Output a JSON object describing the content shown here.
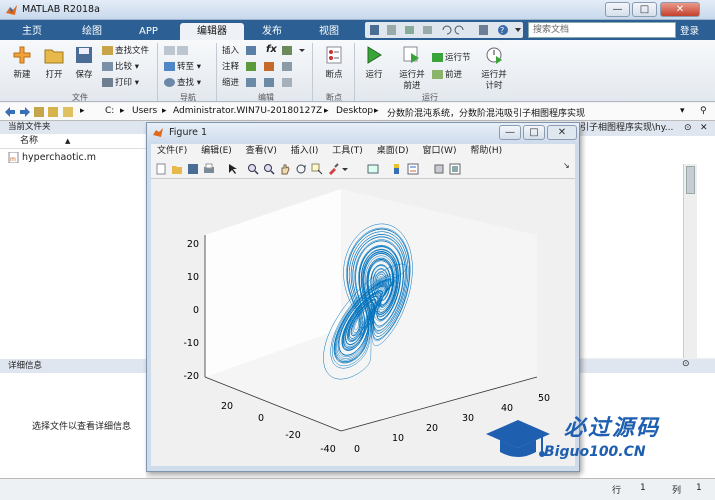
{
  "app": {
    "title": "MATLAB R2018a",
    "login": "登录"
  },
  "window_buttons": {
    "minimize": "—",
    "maximize": "□",
    "close": "✕"
  },
  "tabs": [
    {
      "label": "主页",
      "active": false
    },
    {
      "label": "绘图",
      "active": false
    },
    {
      "label": "APP",
      "active": false
    },
    {
      "label": "编辑器",
      "active": true
    },
    {
      "label": "发布",
      "active": false
    },
    {
      "label": "视图",
      "active": false
    }
  ],
  "search": {
    "placeholder": "搜索文档"
  },
  "ribbon": {
    "file": {
      "new": "新建",
      "open": "打开",
      "save": "保存",
      "find_files": "查找文件",
      "compare": "比较",
      "print": "打印",
      "section": "文件"
    },
    "navigate": {
      "goto": "转至",
      "find": "查找",
      "section": "导航"
    },
    "edit": {
      "insert": "插入",
      "comment": "注释",
      "indent": "缩进",
      "fx": "fx",
      "section": "编辑"
    },
    "breakpoints": {
      "label": "断点",
      "section": "断点"
    },
    "run": {
      "run": "运行",
      "run_advance_1": "运行并",
      "run_advance_2": "前进",
      "run_section": "运行节",
      "advance": "前进",
      "run_time_1": "运行并",
      "run_time_2": "计时",
      "section": "运行"
    }
  },
  "path": [
    "C:",
    "Users",
    "Administrator.WIN7U-20180127Z",
    "Desktop",
    "分数阶混沌系统，分数阶混沌吸引子相图程序实现"
  ],
  "left_panel": {
    "header": "当前文件夹",
    "column": "名称",
    "column_sort": "▲",
    "files": [
      "hyperchaotic.m"
    ],
    "details_header": "详细信息",
    "details_text": "选择文件以查看详细信息"
  },
  "right_panel": {
    "header_text": "引子相图程序实现\\hy..."
  },
  "status": {
    "row_label": "行",
    "row_value": "1",
    "col_label": "列",
    "col_value": "1"
  },
  "figure": {
    "title": "Figure 1",
    "menus": [
      "文件(F)",
      "编辑(E)",
      "查看(V)",
      "插入(I)",
      "工具(T)",
      "桌面(D)",
      "窗口(W)",
      "帮助(H)"
    ],
    "z_ticks": [
      "20",
      "10",
      "0",
      "-10",
      "-20"
    ],
    "x_ticks": [
      "20",
      "0",
      "-20",
      "-40"
    ],
    "y_ticks": [
      "0",
      "10",
      "20",
      "30",
      "40",
      "50"
    ],
    "line_color": "#0072bd"
  },
  "watermark": {
    "chinese": "必过源码",
    "url": "Biguo100.CN"
  },
  "colors": {
    "accent": "#2c5f93",
    "watermark_blue": "#1f5fb0",
    "watermark_red": "#d02020"
  }
}
